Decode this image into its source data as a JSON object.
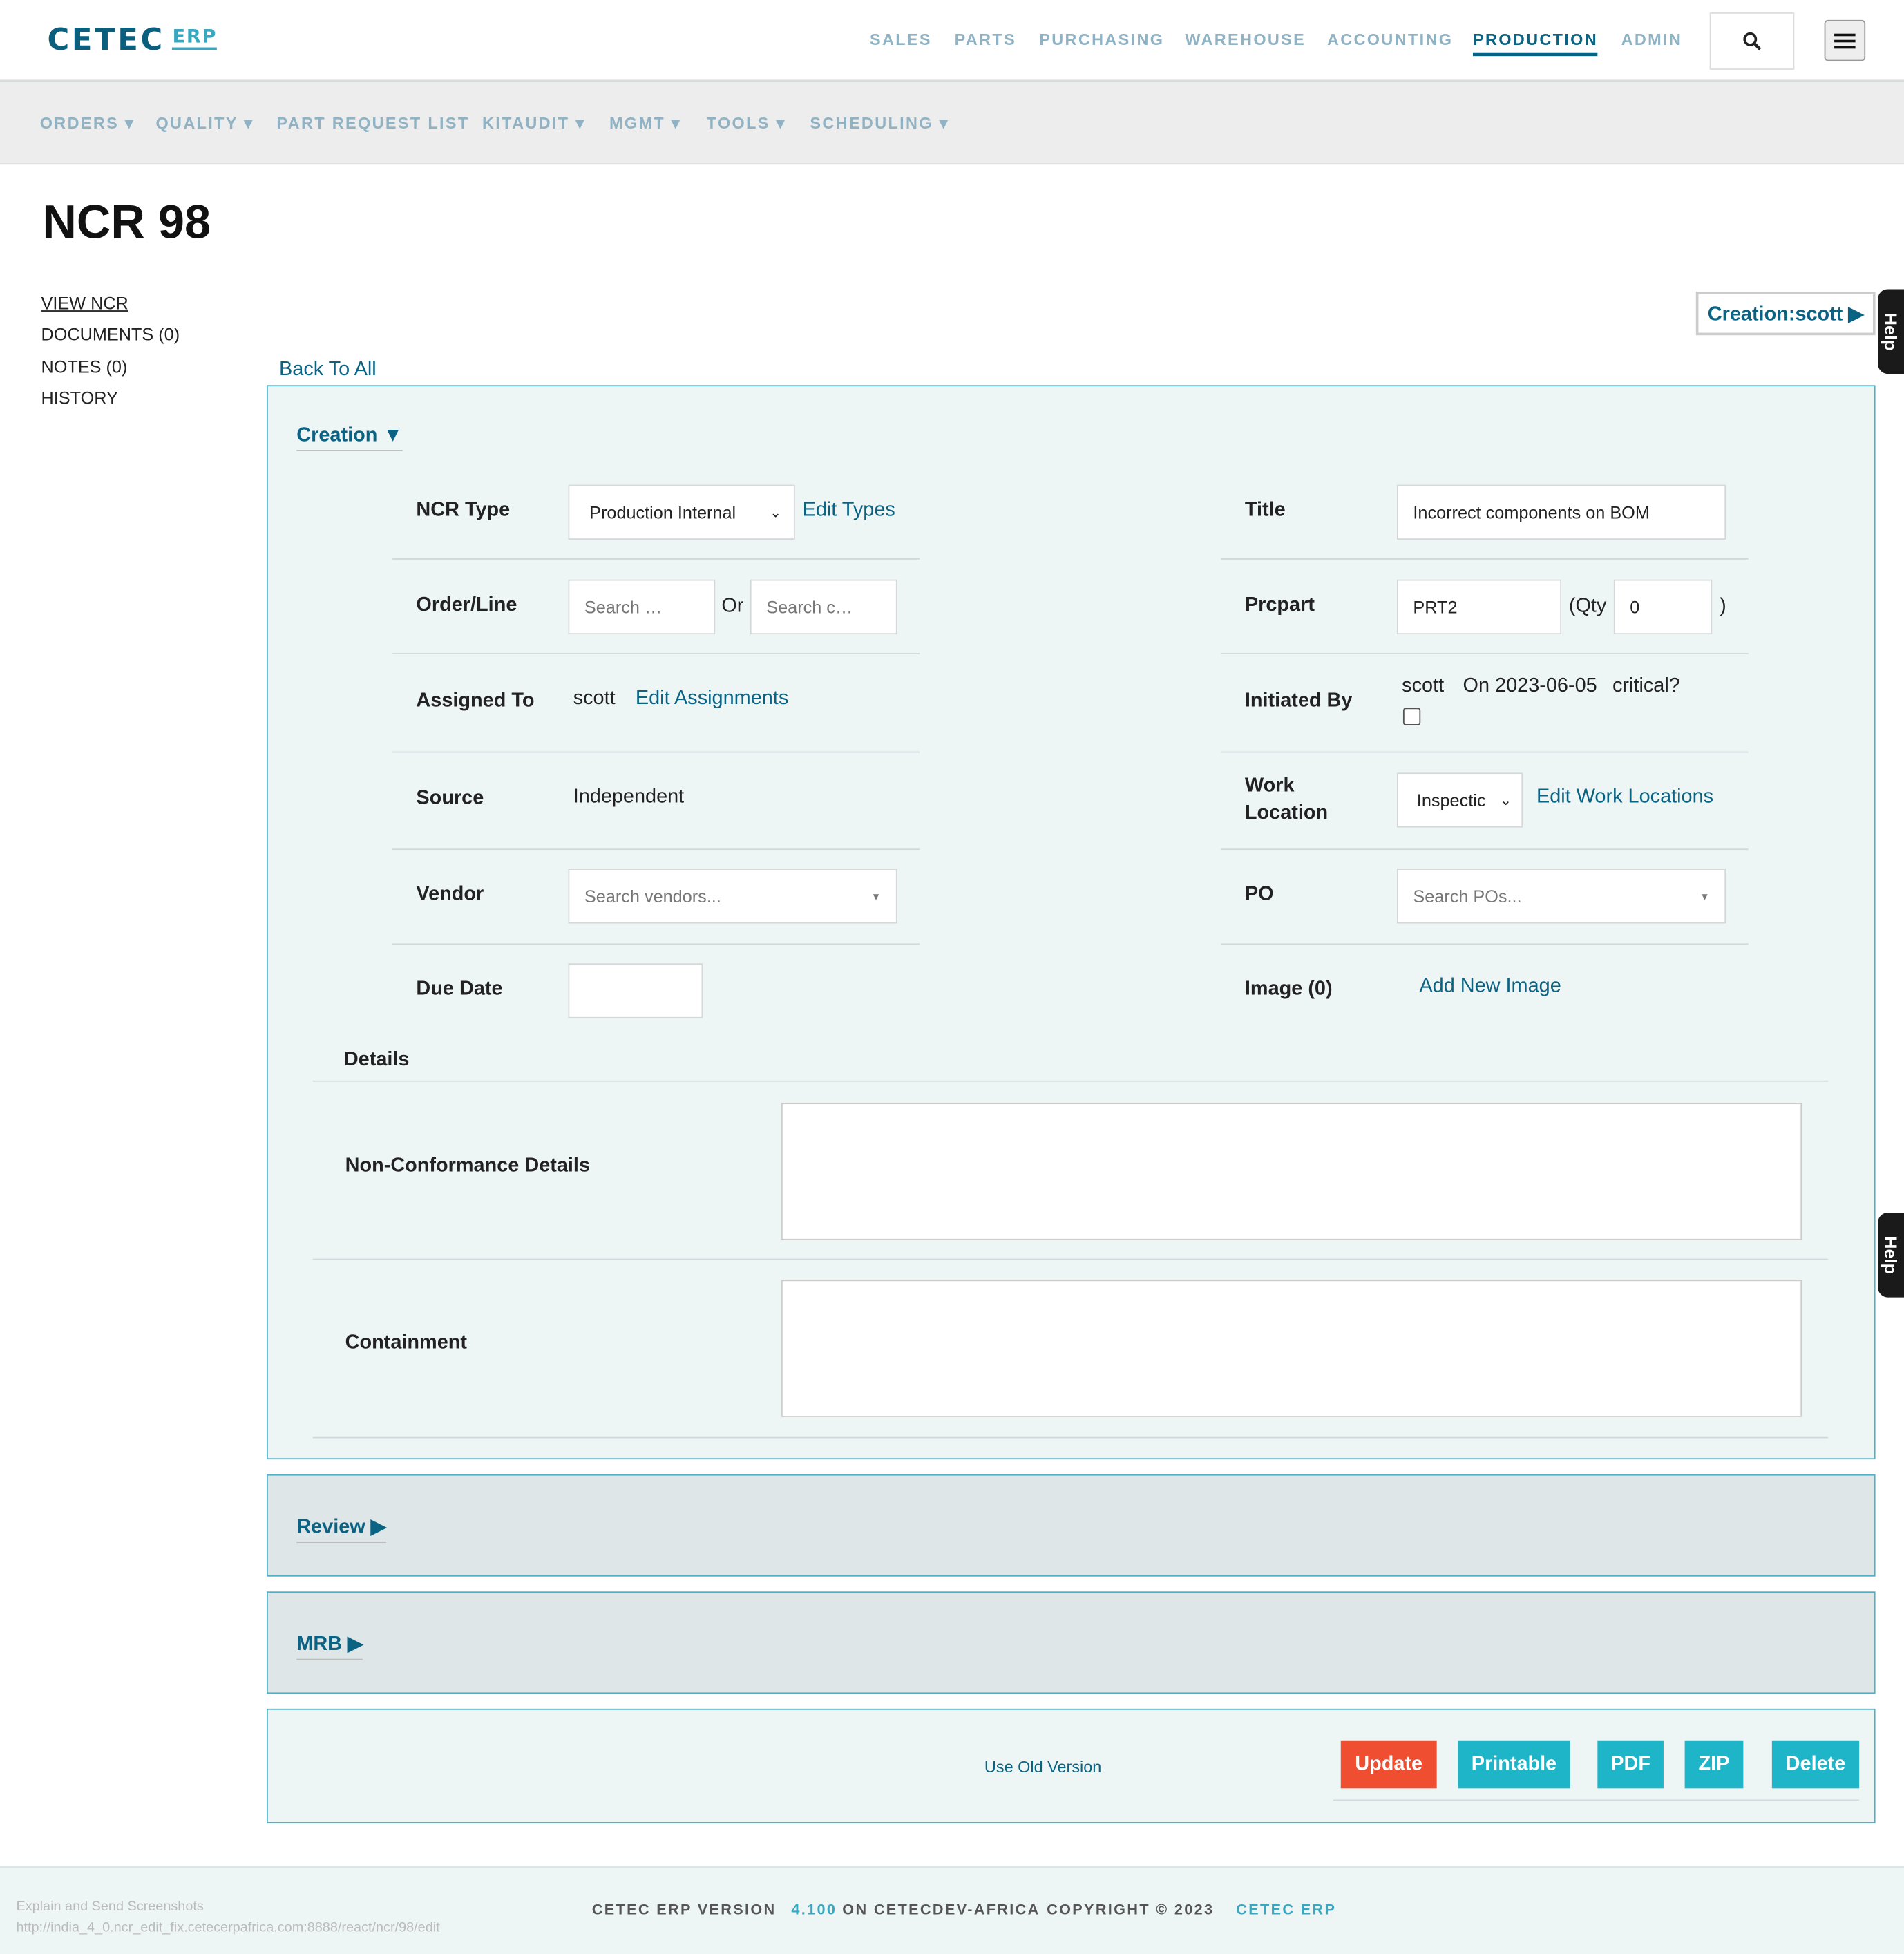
{
  "brand": {
    "name": "CETEC",
    "suffix": "ERP"
  },
  "topnav": [
    "SALES",
    "PARTS",
    "PURCHASING",
    "WAREHOUSE",
    "ACCOUNTING",
    "PRODUCTION",
    "ADMIN"
  ],
  "subnav": [
    "ORDERS ▾",
    "QUALITY ▾",
    "PART REQUEST LIST",
    "KITAUDIT ▾",
    "MGMT ▾",
    "TOOLS ▾",
    "SCHEDULING ▾"
  ],
  "page_title": "NCR 98",
  "sidebar": [
    "VIEW NCR",
    "DOCUMENTS (0)",
    "NOTES (0)",
    "HISTORY"
  ],
  "creation_button": "Creation:scott ▶",
  "help": "Help",
  "back": "Back To All",
  "creation": {
    "header": "Creation ▼",
    "ncr_type_label": "NCR Type",
    "ncr_type_value": "Production Internal",
    "edit_types": "Edit Types",
    "title_label": "Title",
    "title_value": "Incorrect components on BOM",
    "order_label": "Order/Line",
    "order_ph": "Search …",
    "or": "Or",
    "order_ph2": "Search c…",
    "prcpart_label": "Prcpart",
    "prcpart_value": "PRT2",
    "qty_label": "(Qty",
    "qty_value": "0",
    "qty_close": ")",
    "assigned_label": "Assigned To",
    "assigned_value": "scott",
    "edit_assign": "Edit Assignments",
    "initiated_label": "Initiated By",
    "initiated_by": "scott",
    "initiated_on": "On 2023-06-05",
    "critical": "critical?",
    "source_label": "Source",
    "source_value": "Independent",
    "work_label": "Work Location",
    "work_value": "Inspectic",
    "edit_work": "Edit Work Locations",
    "vendor_label": "Vendor",
    "vendor_ph": "Search vendors...",
    "po_label": "PO",
    "po_ph": "Search POs...",
    "due_label": "Due Date",
    "image_label": "Image (0)",
    "add_image": "Add New Image",
    "details": "Details",
    "ncd_label": "Non-Conformance Details",
    "containment_label": "Containment"
  },
  "review": "Review ▶",
  "mrb": "MRB ▶",
  "actions": {
    "old": "Use Old Version",
    "update": "Update",
    "printable": "Printable",
    "pdf": "PDF",
    "zip": "ZIP",
    "delete": "Delete"
  },
  "colors": {
    "update": "#f04e30",
    "action": "#1fb5c9",
    "brand": "#0b6384"
  },
  "footer": {
    "version_label": "CETEC ERP VERSION",
    "version": "4.100",
    "on": "ON CETECDEV-AFRICA",
    "copyright": "COPYRIGHT © 2023",
    "link": "CETEC ERP",
    "explain": "Explain and Send Screenshots",
    "url": "http://india_4_0.ncr_edit_fix.cetecerpafrica.com:8888/react/ncr/98/edit"
  }
}
